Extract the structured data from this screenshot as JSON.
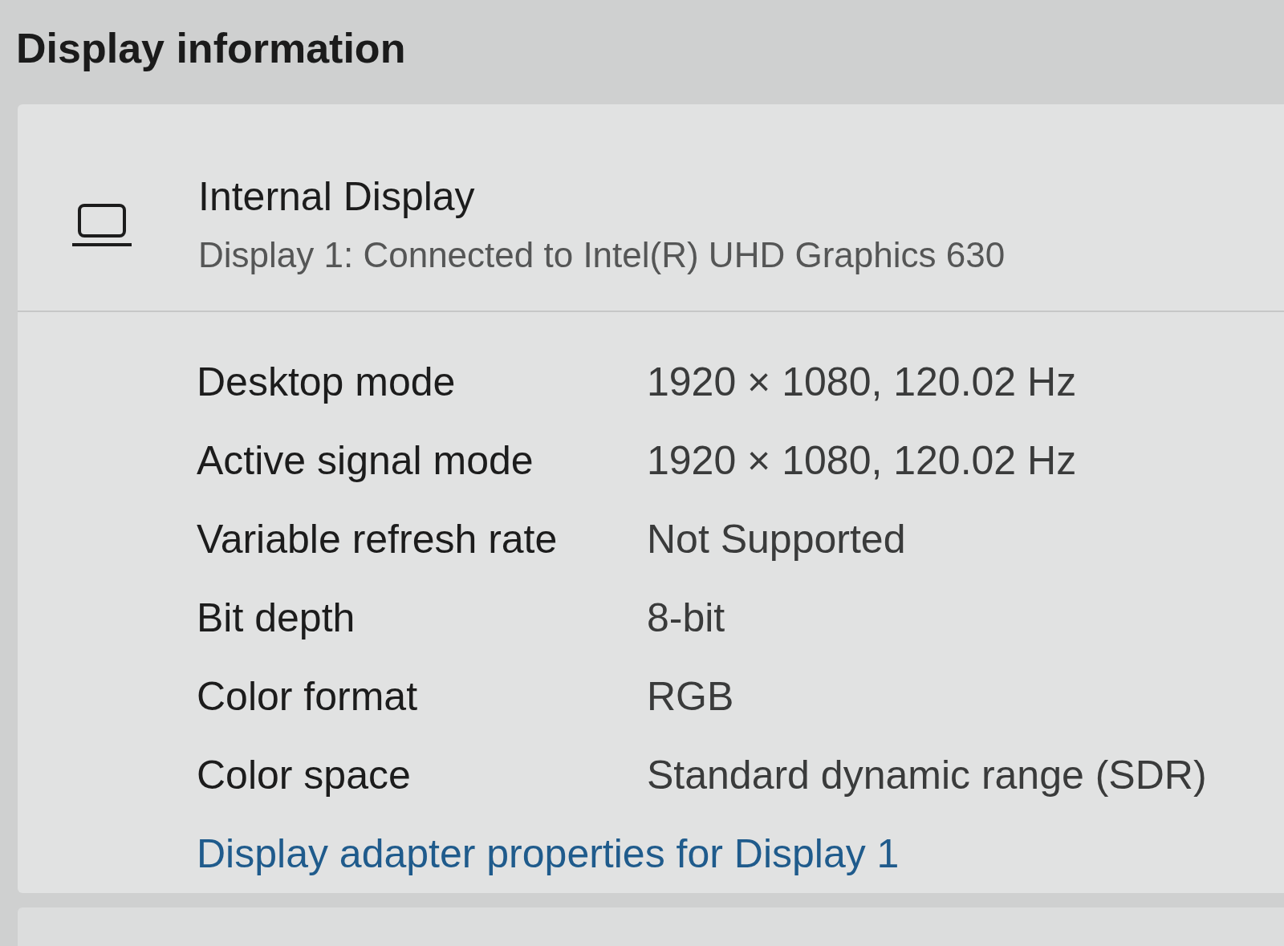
{
  "section_title": "Display information",
  "display": {
    "name": "Internal Display",
    "description": "Display 1: Connected to Intel(R) UHD Graphics 630"
  },
  "properties": [
    {
      "label": "Desktop mode",
      "value": "1920 × 1080, 120.02 Hz"
    },
    {
      "label": "Active signal mode",
      "value": "1920 × 1080, 120.02 Hz"
    },
    {
      "label": "Variable refresh rate",
      "value": "Not Supported"
    },
    {
      "label": "Bit depth",
      "value": "8-bit"
    },
    {
      "label": "Color format",
      "value": "RGB"
    },
    {
      "label": "Color space",
      "value": "Standard dynamic range (SDR)"
    }
  ],
  "link": "Display adapter properties for Display 1"
}
